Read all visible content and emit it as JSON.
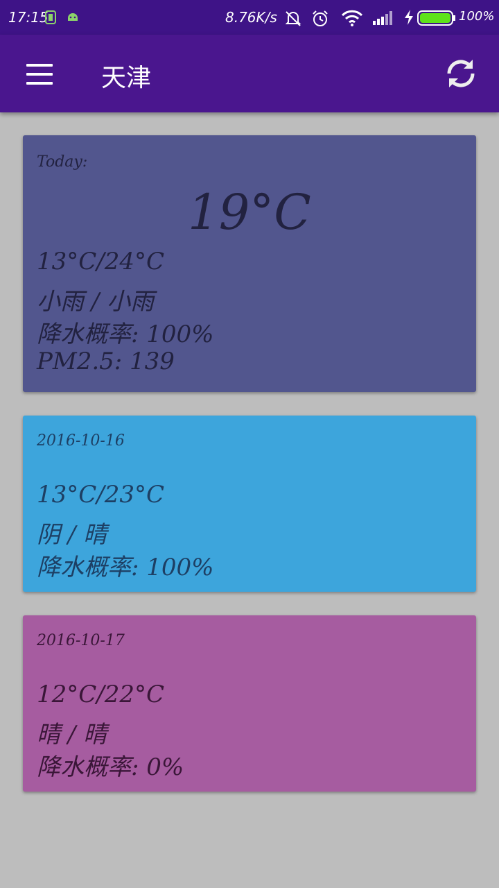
{
  "status_bar": {
    "time": "17:15",
    "network_speed": "8.76K/s",
    "battery_percent": "100%",
    "icons": [
      "sim-icon",
      "android-icon",
      "bell-off-icon",
      "alarm-icon",
      "wifi-icon",
      "signal-icon",
      "charging-icon",
      "battery-icon"
    ]
  },
  "app_bar": {
    "city": "天津",
    "background": "#4a168e"
  },
  "today": {
    "label": "Today:",
    "current_temp": "19°C",
    "temp_range": "13°C/24°C",
    "weather": "小雨 / 小雨",
    "precip": "降水概率: 100%",
    "pm25": "PM2.5: 139",
    "color": "#52568e"
  },
  "forecast": [
    {
      "date": "2016-10-16",
      "temp_range": "13°C/23°C",
      "weather": "阴 / 晴",
      "precip": "降水概率: 100%",
      "color": "#3da5dc"
    },
    {
      "date": "2016-10-17",
      "temp_range": "12°C/22°C",
      "weather": "晴 / 晴",
      "precip": "降水概率: 0%",
      "color": "#a65ca0"
    }
  ]
}
